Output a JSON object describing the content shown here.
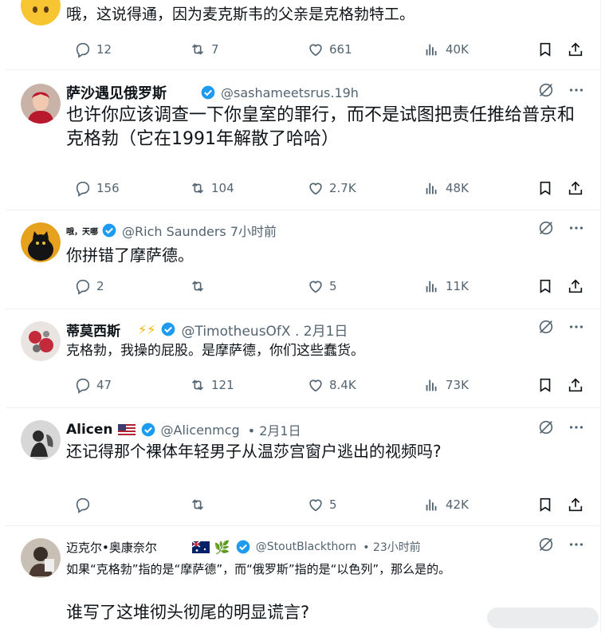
{
  "colors": {
    "accent": "#1d9bf0",
    "text": "#0f1419",
    "muted": "#536471",
    "border": "#eff3f4"
  },
  "tweets": [
    {
      "id": "t0",
      "body": "哦，这说得通，因为麦克斯韦的父亲是克格勃特工。",
      "counts": {
        "replies": "12",
        "reposts": "7",
        "likes": "661",
        "views": "40K"
      }
    },
    {
      "id": "t1",
      "name": "萨沙遇见俄罗斯",
      "handle": "@sashameetsrus.19h",
      "body": "也许你应该调查一下你皇室的罪行，而不是试图把责任推给普京和克格勃（它在1991年解散了哈哈）",
      "counts": {
        "replies": "156",
        "reposts": "104",
        "likes": "2.7K",
        "views": "48K"
      }
    },
    {
      "id": "t2",
      "name": "哦，天哪",
      "handle": "@Rich Saunders 7小时前",
      "body": "你拼错了摩萨德。",
      "counts": {
        "replies": "2",
        "reposts": "",
        "likes": "5",
        "views": "11K"
      }
    },
    {
      "id": "t3",
      "name": "蒂莫西斯",
      "emoji": "⚡⚡",
      "handle": "@TimotheusOfX . 2月1日",
      "body": "克格勃，我操的屁股。是摩萨德，你们这些蠢货。",
      "counts": {
        "replies": "47",
        "reposts": "121",
        "likes": "8.4K",
        "views": "73K"
      }
    },
    {
      "id": "t4",
      "name": "Alicen",
      "handle": "@Alicenmcg",
      "date": "• 2月1日",
      "body": "还记得那个裸体年轻男子从温莎宫窗户逃出的视频吗?",
      "counts": {
        "replies": "",
        "reposts": "",
        "likes": "5",
        "views": "42K"
      }
    },
    {
      "id": "t5",
      "name": "迈克尔•奥康奈尔",
      "emoji": "🌿",
      "handle": "@StoutBlackthorn",
      "date": "• 23小时前",
      "body": "如果“克格勃”指的是“摩萨德”，而“俄罗斯”指的是“以色列”，那么是的。",
      "body2": "谁写了这堆彻头彻尾的明显谎言?"
    }
  ]
}
